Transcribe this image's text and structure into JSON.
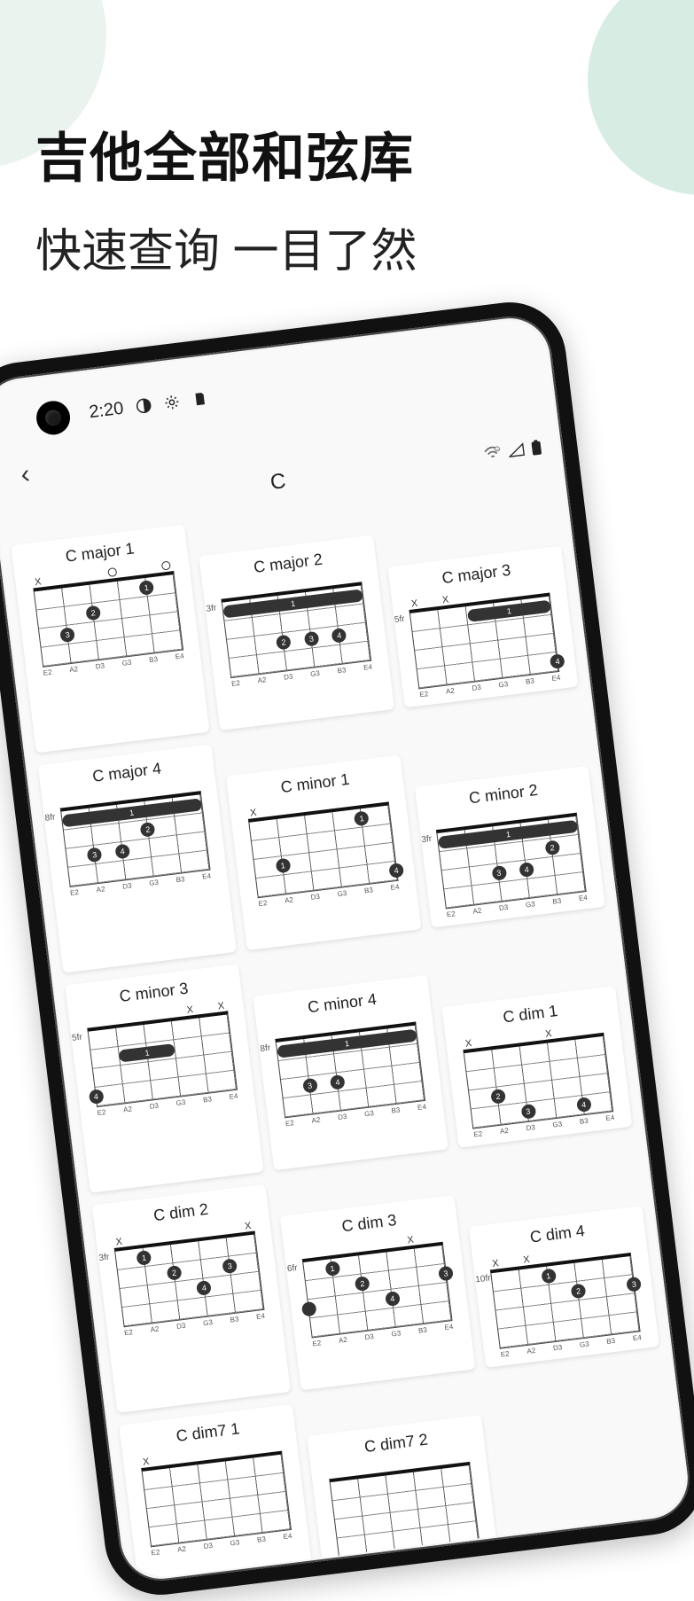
{
  "marketing": {
    "title": "吉他全部和弦库",
    "subtitle": "快速查询 一目了然"
  },
  "statusbar": {
    "time": "2:20",
    "icons": [
      "curfew-icon",
      "gear-icon",
      "sd-icon"
    ]
  },
  "app": {
    "back_glyph": "‹",
    "page_title": "C"
  },
  "string_labels": [
    "E2",
    "A2",
    "D3",
    "G3",
    "B3",
    "E4"
  ],
  "chords": [
    {
      "name": "C major 1",
      "top": [
        "X",
        "",
        "",
        "O",
        "",
        "O"
      ],
      "fret_label": "",
      "dots": [
        {
          "s": 1,
          "f": 3,
          "n": "3"
        },
        {
          "s": 2,
          "f": 2,
          "n": "2"
        },
        {
          "s": 4,
          "f": 1,
          "n": "1"
        }
      ],
      "barres": []
    },
    {
      "name": "C major 2",
      "top": [
        "",
        "",
        "",
        "",
        "",
        ""
      ],
      "fret_label": "3fr",
      "dots": [
        {
          "s": 2,
          "f": 3,
          "n": "2"
        },
        {
          "s": 3,
          "f": 3,
          "n": "3"
        },
        {
          "s": 4,
          "f": 3,
          "n": "4"
        }
      ],
      "barres": [
        {
          "from": 0,
          "to": 5,
          "f": 1,
          "n": "1"
        }
      ]
    },
    {
      "name": "C major 3",
      "top": [
        "X",
        "X",
        "",
        "",
        "",
        ""
      ],
      "fret_label": "5fr",
      "dots": [
        {
          "s": 5,
          "f": 4,
          "n": "4"
        }
      ],
      "barres": [
        {
          "from": 2,
          "to": 5,
          "f": 1,
          "n": "1"
        }
      ]
    },
    {
      "name": "C major 4",
      "top": [
        "",
        "",
        "",
        "",
        "",
        ""
      ],
      "fret_label": "8fr",
      "dots": [
        {
          "s": 1,
          "f": 3,
          "n": "3"
        },
        {
          "s": 2,
          "f": 3,
          "n": "4"
        },
        {
          "s": 3,
          "f": 2,
          "n": "2"
        }
      ],
      "barres": [
        {
          "from": 0,
          "to": 5,
          "f": 1,
          "n": "1"
        }
      ]
    },
    {
      "name": "C minor 1",
      "top": [
        "X",
        "",
        "",
        "",
        "",
        ""
      ],
      "fret_label": "",
      "dots": [
        {
          "s": 1,
          "f": 3,
          "n": "1"
        },
        {
          "s": 4,
          "f": 1,
          "n": "1"
        },
        {
          "s": 5,
          "f": 4,
          "n": "4"
        }
      ],
      "barres": []
    },
    {
      "name": "C minor 2",
      "top": [
        "",
        "",
        "",
        "",
        "",
        ""
      ],
      "fret_label": "3fr",
      "dots": [
        {
          "s": 2,
          "f": 3,
          "n": "3"
        },
        {
          "s": 3,
          "f": 3,
          "n": "4"
        },
        {
          "s": 4,
          "f": 2,
          "n": "2"
        }
      ],
      "barres": [
        {
          "from": 0,
          "to": 5,
          "f": 1,
          "n": "1"
        }
      ]
    },
    {
      "name": "C minor 3",
      "top": [
        "",
        "",
        "",
        "",
        "X",
        "X"
      ],
      "fret_label": "5fr",
      "dots": [
        {
          "s": 0,
          "f": 4,
          "n": "4"
        }
      ],
      "barres": [
        {
          "from": 1,
          "to": 3,
          "f": 2,
          "n": "1"
        }
      ]
    },
    {
      "name": "C minor 4",
      "top": [
        "",
        "",
        "",
        "",
        "",
        ""
      ],
      "fret_label": "8fr",
      "dots": [
        {
          "s": 1,
          "f": 3,
          "n": "3"
        },
        {
          "s": 2,
          "f": 3,
          "n": "4"
        }
      ],
      "barres": [
        {
          "from": 0,
          "to": 5,
          "f": 1,
          "n": "1"
        }
      ]
    },
    {
      "name": "C dim 1",
      "top": [
        "X",
        "",
        "",
        "X",
        "",
        ""
      ],
      "fret_label": "",
      "dots": [
        {
          "s": 1,
          "f": 3,
          "n": "2"
        },
        {
          "s": 2,
          "f": 4,
          "n": "3"
        },
        {
          "s": 4,
          "f": 4,
          "n": "4"
        }
      ],
      "barres": []
    },
    {
      "name": "C dim 2",
      "top": [
        "X",
        "",
        "",
        "",
        "",
        "X"
      ],
      "fret_label": "3fr",
      "dots": [
        {
          "s": 1,
          "f": 1,
          "n": "1"
        },
        {
          "s": 2,
          "f": 2,
          "n": "2"
        },
        {
          "s": 3,
          "f": 3,
          "n": "4"
        },
        {
          "s": 4,
          "f": 2,
          "n": "3"
        }
      ],
      "barres": []
    },
    {
      "name": "C dim 3",
      "top": [
        "",
        "",
        "",
        "",
        "X",
        ""
      ],
      "fret_label": "6fr",
      "dots": [
        {
          "s": 0,
          "f": 3,
          "n": ""
        },
        {
          "s": 1,
          "f": 1,
          "n": "1"
        },
        {
          "s": 2,
          "f": 2,
          "n": "2"
        },
        {
          "s": 3,
          "f": 3,
          "n": "4"
        },
        {
          "s": 5,
          "f": 2,
          "n": "3"
        }
      ],
      "barres": []
    },
    {
      "name": "C dim 4",
      "top": [
        "X",
        "X",
        "",
        "",
        "",
        ""
      ],
      "fret_label": "10fr",
      "dots": [
        {
          "s": 2,
          "f": 1,
          "n": "1"
        },
        {
          "s": 3,
          "f": 2,
          "n": "2"
        },
        {
          "s": 5,
          "f": 2,
          "n": "3"
        }
      ],
      "barres": []
    },
    {
      "name": "C dim7 1",
      "top": [
        "X",
        "",
        "",
        "",
        "",
        ""
      ],
      "fret_label": "",
      "dots": [],
      "barres": []
    },
    {
      "name": "C dim7 2",
      "top": [
        "",
        "",
        "",
        "",
        "",
        ""
      ],
      "fret_label": "",
      "dots": [],
      "barres": []
    }
  ]
}
